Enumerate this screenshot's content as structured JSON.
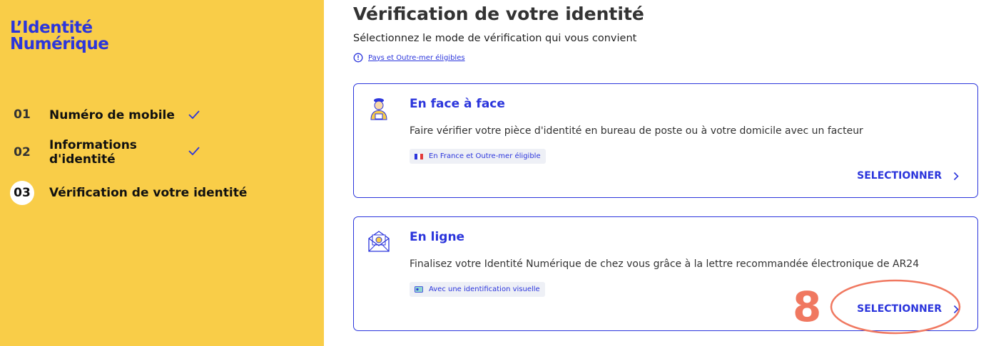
{
  "sidebar": {
    "logo_line1": "L’Identité",
    "logo_line2": "Numérique",
    "steps": [
      {
        "num": "01",
        "label": "Numéro de mobile"
      },
      {
        "num": "02",
        "label_line1": "Informations",
        "label_line2": "d'identité"
      },
      {
        "num": "03",
        "label": "Vérification de votre identité"
      }
    ]
  },
  "main": {
    "title": "Vérification de votre identité",
    "subtitle": "Sélectionnez le mode de vérification qui vous convient",
    "eligibility_link": "Pays et Outre-mer éligibles"
  },
  "cards": [
    {
      "title": "En face à face",
      "description": "Faire vérifier votre pièce d'identité en bureau de poste ou à votre domicile avec un facteur",
      "tag": "En France et Outre-mer éligible",
      "button": "SELECTIONNER"
    },
    {
      "title": "En ligne",
      "description": "Finalisez votre Identité Numérique de chez vous grâce à la lettre recommandée électronique de AR24",
      "tag": "Avec une identification visuelle",
      "button": "SELECTIONNER"
    }
  ],
  "annotation": {
    "number": "8"
  },
  "colors": {
    "sidebar_bg": "#f9cd48",
    "accent": "#2b35dc",
    "annotation": "#f07860"
  }
}
